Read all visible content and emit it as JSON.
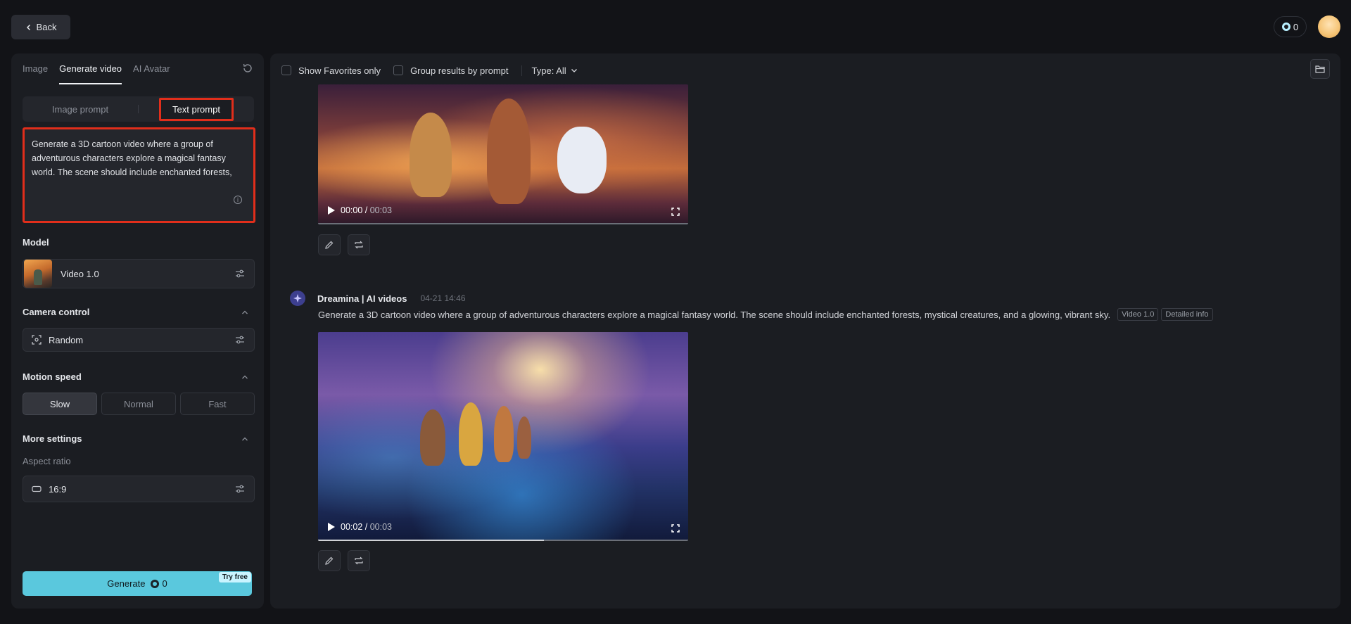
{
  "topbar": {
    "back_label": "Back",
    "credits": "0"
  },
  "left": {
    "tabs": [
      {
        "label": "Image"
      },
      {
        "label": "Generate video"
      },
      {
        "label": "AI Avatar"
      }
    ],
    "prompt_mode": {
      "image_prompt": "Image prompt",
      "text_prompt": "Text prompt"
    },
    "prompt_text": "Generate a 3D cartoon video where a group of adventurous characters explore a magical fantasy world. The scene should include enchanted forests, mystical creatures, and a glowing, vibrant sky.",
    "model": {
      "section_label": "Model",
      "name": "Video 1.0"
    },
    "camera": {
      "section_label": "Camera control",
      "value": "Random"
    },
    "motion": {
      "section_label": "Motion speed",
      "options": [
        "Slow",
        "Normal",
        "Fast"
      ],
      "selected": "Slow"
    },
    "more": {
      "section_label": "More settings",
      "aspect_label": "Aspect ratio",
      "aspect_value": "16:9"
    },
    "generate": {
      "label": "Generate",
      "cost": "0",
      "badge": "Try free"
    }
  },
  "main": {
    "filters": {
      "favorites": "Show Favorites only",
      "group": "Group results by prompt",
      "type": "Type: All"
    },
    "video1": {
      "current": "00:00",
      "duration": "00:03",
      "progress": 0.0
    },
    "message": {
      "bot_name": "Dreamina | AI videos",
      "timestamp": "04-21  14:46",
      "prompt": "Generate a 3D cartoon video where a group of adventurous characters explore a magical fantasy world. The scene should include enchanted forests, mystical creatures, and a glowing, vibrant sky.",
      "tag_model": "Video 1.0",
      "tag_info": "Detailed info"
    },
    "video2": {
      "current": "00:02",
      "duration": "00:03",
      "progress": 0.61
    }
  },
  "colors": {
    "accent": "#5ac8dd",
    "highlight": "#e12e1b",
    "panel": "#1b1d22",
    "background": "#121317"
  }
}
